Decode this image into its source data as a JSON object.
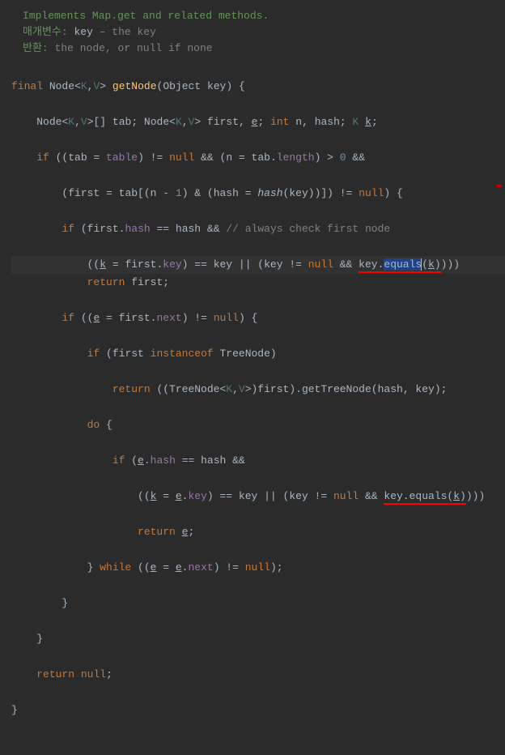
{
  "doc": {
    "summary": "Implements Map.get and related methods.",
    "param_label": "매개변수:",
    "param_name": "key",
    "param_desc": "– the key",
    "return_label": "반환:",
    "return_desc": "the node, or null if none"
  },
  "code": {
    "kw_final": "final",
    "type_node": "Node",
    "tp_k": "K",
    "tp_v": "V",
    "method_name": "getNode",
    "type_object": "Object",
    "param_key": "key",
    "var_tab": "tab",
    "var_first": "first",
    "var_e": "e",
    "type_int": "int",
    "var_n": "n",
    "var_hash": "hash",
    "var_k": "k",
    "kw_if": "if",
    "field_table": "table",
    "kw_null": "null",
    "field_length": "length",
    "num_0": "0",
    "num_1": "1",
    "fn_hash": "hash",
    "field_hash": "hash",
    "comment_first": "// always check first node",
    "field_key": "key",
    "method_equals": "equals",
    "kw_return": "return",
    "field_next": "next",
    "kw_instanceof": "instanceof",
    "type_treenode": "TreeNode",
    "method_gettreenode": "getTreeNode",
    "kw_do": "do",
    "kw_while": "while"
  }
}
